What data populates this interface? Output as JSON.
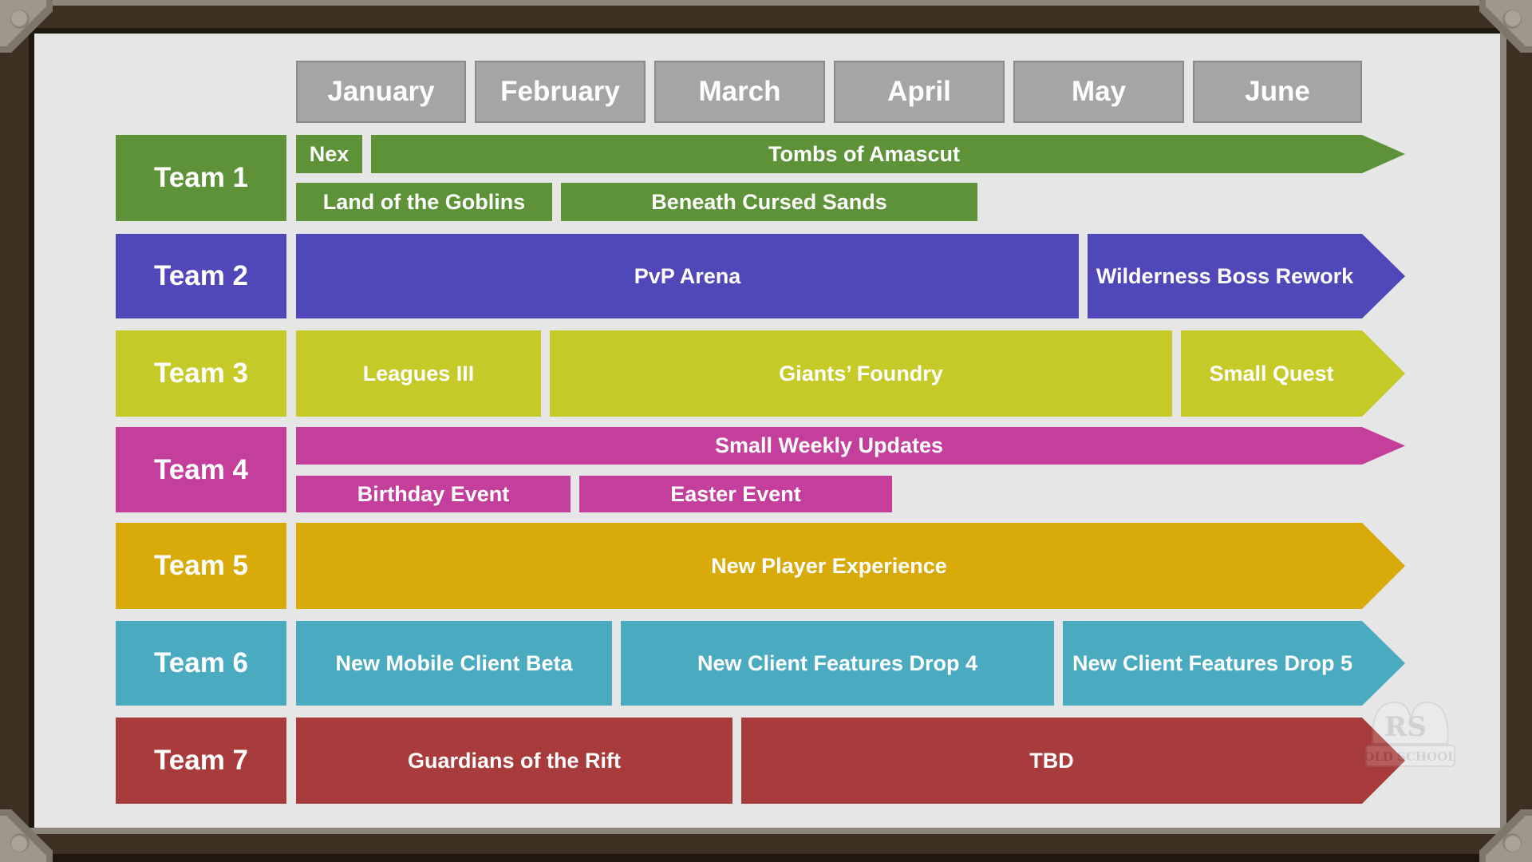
{
  "months": [
    "January",
    "February",
    "March",
    "April",
    "May",
    "June"
  ],
  "colors": {
    "month": "#A5A5A5",
    "team1": "#5E9239",
    "team2": "#5048B8",
    "team3": "#C6CA28",
    "team4": "#C43F9C",
    "team5": "#D8AB0A",
    "team6": "#4AAAC0",
    "team7": "#A83C3C"
  },
  "teams": [
    {
      "label": "Team 1",
      "projects": [
        {
          "name": "Nex",
          "start": "January",
          "end": "January (early)"
        },
        {
          "name": "Tombs of Amascut",
          "start": "January",
          "end": "June+",
          "continues": true
        },
        {
          "name": "Land of the Goblins",
          "start": "January",
          "end": "February (mid)"
        },
        {
          "name": "Beneath Cursed Sands",
          "start": "February (mid)",
          "end": "April (end)"
        }
      ]
    },
    {
      "label": "Team 2",
      "projects": [
        {
          "name": "PvP Arena",
          "start": "January",
          "end": "May (early)"
        },
        {
          "name": "Wilderness Boss Rework",
          "start": "May (early)",
          "end": "June+",
          "continues": true
        }
      ]
    },
    {
      "label": "Team 3",
      "projects": [
        {
          "name": "Leagues III",
          "start": "January",
          "end": "February (mid)"
        },
        {
          "name": "Giants’ Foundry",
          "start": "February (mid)",
          "end": "May (end)"
        },
        {
          "name": "Small Quest",
          "start": "June",
          "end": "June+",
          "continues": true
        }
      ]
    },
    {
      "label": "Team 4",
      "projects": [
        {
          "name": "Small Weekly Updates",
          "start": "January",
          "end": "June+",
          "continues": true
        },
        {
          "name": "Birthday Event",
          "start": "January",
          "end": "February (mid)"
        },
        {
          "name": "Easter Event",
          "start": "February (mid)",
          "end": "April (early)"
        }
      ]
    },
    {
      "label": "Team 5",
      "projects": [
        {
          "name": "New Player Experience",
          "start": "January",
          "end": "June+",
          "continues": true
        }
      ]
    },
    {
      "label": "Team 6",
      "projects": [
        {
          "name": "New Mobile Client Beta",
          "start": "January",
          "end": "February (end)"
        },
        {
          "name": "New Client Features Drop 4",
          "start": "March",
          "end": "April (end)"
        },
        {
          "name": "New Client Features Drop 5",
          "start": "May",
          "end": "June+",
          "continues": true
        }
      ]
    },
    {
      "label": "Team 7",
      "projects": [
        {
          "name": "Guardians of the Rift",
          "start": "January",
          "end": "March (early)"
        },
        {
          "name": "TBD",
          "start": "March (early)",
          "end": "June+",
          "continues": true
        }
      ]
    }
  ],
  "watermark": {
    "mark": "RS",
    "text": "OLD SCHOOL"
  }
}
